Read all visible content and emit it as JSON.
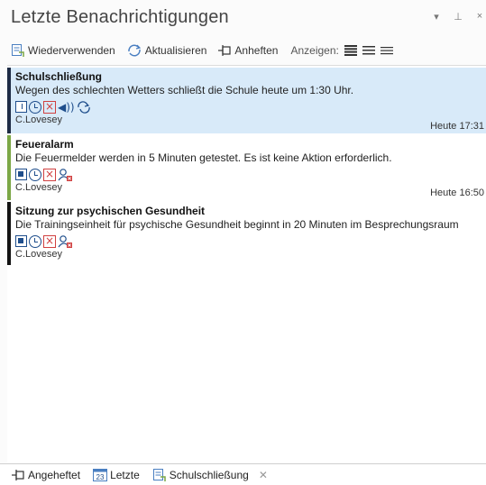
{
  "window": {
    "title": "Letzte Benachrichtigungen",
    "controls": [
      "▾",
      "⊥",
      "×"
    ]
  },
  "toolbar": {
    "reuse": "Wiederverwenden",
    "refresh": "Aktualisieren",
    "pin": "Anheften",
    "show": "Anzeigen:"
  },
  "notifications": [
    {
      "title": "Schulschließung",
      "message": "Wegen des schlechten Wetters schließt die Schule heute um 1:30 Uhr.",
      "sender": "C.Lovesey",
      "time": "Heute 17:31",
      "color": "#1d2b44",
      "selected": true
    },
    {
      "title": "Feueralarm",
      "message": "Die Feuermelder werden in 5 Minuten getestet. Es ist keine Aktion erforderlich.",
      "sender": "C.Lovesey",
      "time": "Heute 16:50",
      "color": "#7aa644",
      "selected": false
    },
    {
      "title": "Sitzung zur psychischen Gesundheit",
      "message": "Die Trainingseinheit für psychische Gesundheit beginnt in 20 Minuten im Besprechungsraum",
      "sender": "C.Lovesey",
      "time": "",
      "color": "#111111",
      "selected": false
    }
  ],
  "tabs": {
    "pinned": "Angeheftet",
    "recent": "Letzte",
    "recent_icon_number": "23",
    "school": "Schulschließung"
  },
  "colors": {
    "accent": "#1f4e8c",
    "selection": "#d8eaf9",
    "danger": "#d04040"
  }
}
